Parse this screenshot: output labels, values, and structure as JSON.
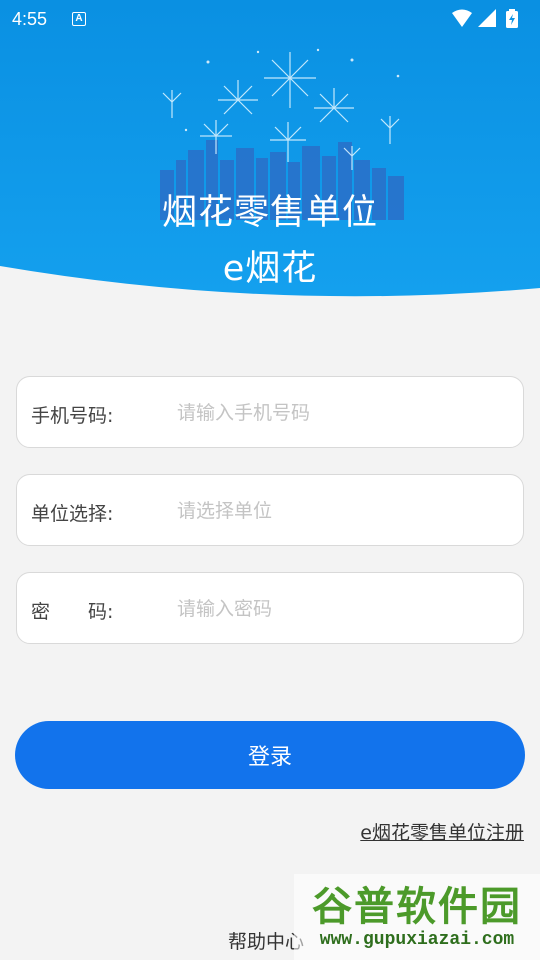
{
  "status_bar": {
    "time": "4:55",
    "notification_letter": "A",
    "icons": [
      "wifi-icon",
      "signal-icon",
      "battery-charging-icon"
    ]
  },
  "header": {
    "title_line1": "烟花零售单位",
    "title_line2": "e烟花",
    "background_color": "#0e94e4"
  },
  "form": {
    "phone": {
      "label": "手机号码:",
      "placeholder": "请输入手机号码",
      "value": ""
    },
    "unit": {
      "label": "单位选择:",
      "placeholder": "请选择单位",
      "value": ""
    },
    "password": {
      "label": "密　　码:",
      "placeholder": "请输入密码",
      "value": ""
    }
  },
  "actions": {
    "login_label": "登录",
    "register_link": "e烟花零售单位注册",
    "help_link": "帮助中心"
  },
  "watermark": {
    "title": "谷普软件园",
    "url": "www.gupuxiazai.com"
  },
  "colors": {
    "primary": "#1273ec",
    "header_blue": "#0e94e4",
    "page_bg": "#f3f3f3"
  }
}
